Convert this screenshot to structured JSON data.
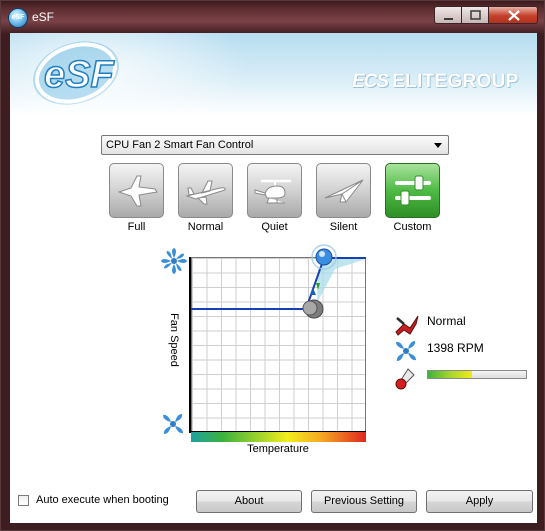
{
  "window": {
    "title": "eSF",
    "icon_label": "eSF"
  },
  "header": {
    "logo_text": "eSF",
    "brand_mark": "ECS",
    "brand_name": "ELITEGROUP"
  },
  "fan_selector": {
    "selected": "CPU Fan 2 Smart Fan Control"
  },
  "modes": [
    {
      "label": "Full",
      "icon": "fighter-jet-icon",
      "active": false
    },
    {
      "label": "Normal",
      "icon": "airliner-icon",
      "active": false
    },
    {
      "label": "Quiet",
      "icon": "helicopter-icon",
      "active": false
    },
    {
      "label": "Silent",
      "icon": "paper-plane-icon",
      "active": false
    },
    {
      "label": "Custom",
      "icon": "sliders-icon",
      "active": true
    }
  ],
  "chart": {
    "ylabel": "Fan Speed",
    "xlabel": "Temperature"
  },
  "status": {
    "mode": "Normal",
    "speed": "1398 RPM",
    "temperature_level": 0.45
  },
  "footer": {
    "auto_execute_label": "Auto execute when booting",
    "auto_execute_checked": false,
    "about_label": "About",
    "previous_label": "Previous Setting",
    "apply_label": "Apply"
  },
  "colors": {
    "accent_blue": "#1a5fc2",
    "active_green": "#4fba45",
    "close_red": "#c4412c"
  }
}
